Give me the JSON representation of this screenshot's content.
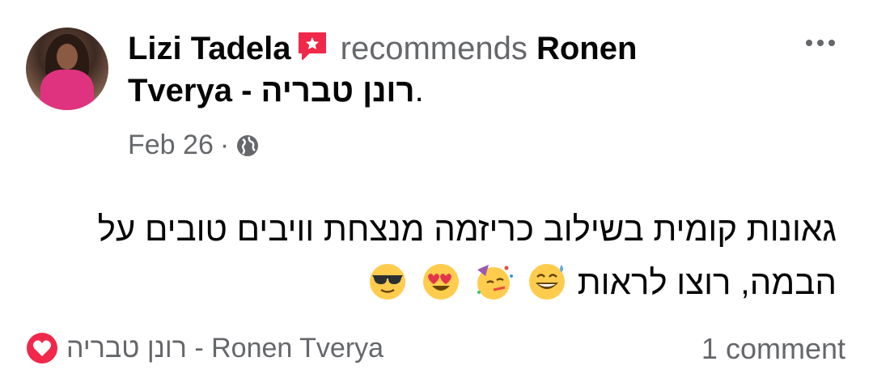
{
  "post": {
    "author": "Lizi Tadela",
    "action": "recommends",
    "page_name_line1": "Ronen",
    "page_name_line2": "Tverya - רונן טבריה",
    "period": ".",
    "date": "Feb 26",
    "separator": "·",
    "body_line1": "גאונות קומית בשילוב כריזמה מנצחת וויבים טובים על",
    "body_line2": "הבמה, רוצו לראות",
    "footer_page": "רונן טבריה - Ronen Tverya",
    "comments": "1 comment"
  },
  "icons": {
    "recommend": "recommend-badge-icon",
    "audience": "globe-icon",
    "more": "more-options-icon",
    "reaction": "heart-icon",
    "emojis": [
      "sweat-smile-emoji",
      "partying-face-emoji",
      "heart-eyes-emoji",
      "sunglasses-emoji"
    ]
  },
  "colors": {
    "recommend_red": "#f02849",
    "text_primary": "#050505",
    "text_secondary": "#65676b"
  }
}
